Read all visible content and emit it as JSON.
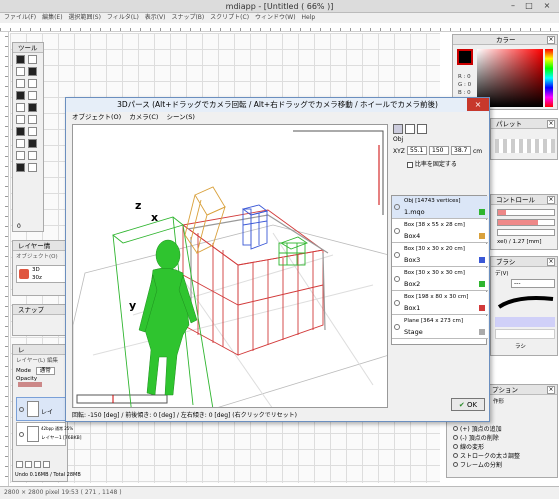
{
  "app": {
    "title": "mdiapp - [Untitled ( 66% )]",
    "window_buttons": [
      "–",
      "□",
      "×"
    ]
  },
  "menu": [
    "ファイル(F)",
    "編集(E)",
    "選択範囲(S)",
    "フィルタ(L)",
    "表示(V)",
    "スナップ(B)",
    "スクリプト(C)",
    "ウィンドウ(W)",
    "Help"
  ],
  "tool_panel": {
    "title": "ツール",
    "value": "0"
  },
  "layer_info_panel": {
    "title": "レイヤー情",
    "object": "オブジェクト(O)",
    "item_label": "3D",
    "item_sub": "30z"
  },
  "snap_panel": {
    "title": "スナップ"
  },
  "layer_panel": {
    "title": "レ",
    "menu": "レイヤー(L)",
    "menu2": "編集",
    "mode_label": "Mode",
    "mode_value": "通常",
    "opacity_label": "Opacity",
    "layers": [
      {
        "name": "レイ",
        "sub": ""
      },
      {
        "name": "レイヤー1 [76BKB]",
        "sub": "42bpp 通常 25%"
      }
    ],
    "footer": "Undo 0.16MB / Total 28MB"
  },
  "color_panel": {
    "title": "カラー",
    "r": "R : 0",
    "g": "G : 0",
    "b": "B : 0"
  },
  "palette_panel": {
    "title": "パレット"
  },
  "control_panel": {
    "title": "コントロール",
    "size_text": "xel) / 1.27 [mm]"
  },
  "brush_panel": {
    "title": "ブラシ",
    "mode": "デ(V)",
    "dropdown": "---",
    "brush_label": "ラシ"
  },
  "option_panel": {
    "title": "プション",
    "sub": "作形",
    "options": [
      "(+) 頂点の追加",
      "(-) 頂点の削除",
      "線の変形",
      "ストロークの太さ調整",
      "フレームの分割"
    ]
  },
  "dialog": {
    "title": "3Dパース (Alt+ドラッグでカメラ回転 / Alt+右ドラッグでカメラ移動 / ホイールでカメラ前後)",
    "close": "×",
    "menu": [
      "オブジェクト(O)",
      "カメラ(C)",
      "シーン(S)"
    ],
    "obj_label": "Obj",
    "xyz_label": "XYZ",
    "xyz_values": [
      "55.1",
      "150",
      "38.7"
    ],
    "xyz_unit": "cm",
    "keep_ratio": "比率を固定する",
    "axis_labels": {
      "x": "x",
      "y": "y",
      "z": "z"
    },
    "objects": [
      {
        "line1": "Obj [14743 vertices]",
        "line2": "1.mqo",
        "color": "#2fb52f",
        "selected": true
      },
      {
        "line1": "Box [38 x 55 x 28 cm]",
        "line2": "Box4",
        "color": "#d9a13c",
        "selected": false
      },
      {
        "line1": "Box [30 x 30 x 20 cm]",
        "line2": "Box3",
        "color": "#3b58d6",
        "selected": false
      },
      {
        "line1": "Box [30 x 30 x 30 cm]",
        "line2": "Box2",
        "color": "#2fb52f",
        "selected": false
      },
      {
        "line1": "Box [198 x 80 x 30 cm]",
        "line2": "Box1",
        "color": "#d23a3a",
        "selected": false
      },
      {
        "line1": "Plane [364 x 273 cm]",
        "line2": "Stage",
        "color": "#aaaaaa",
        "selected": false
      }
    ],
    "ok": "OK",
    "status": "回転: -150 [deg] / 前後傾き: 0 [deg] / 左右傾き: 0 [deg] (右クリックでリセット)"
  },
  "bottom_status": "2800 × 2800 pixel   19:53   ( 271 , 1148 )"
}
